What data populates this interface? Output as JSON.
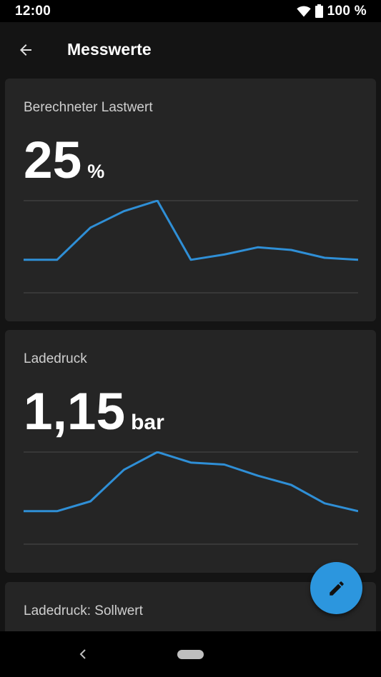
{
  "status_bar": {
    "time": "12:00",
    "battery": "100 %"
  },
  "app_bar": {
    "title": "Messwerte",
    "back_icon": "arrow-back-icon"
  },
  "cards": [
    {
      "label": "Berechneter Lastwert",
      "value": "25",
      "unit": "%",
      "chart_data": {
        "type": "line",
        "color": "#2f8fd6",
        "values": [
          1.0,
          1.0,
          5.9,
          8.4,
          10.0,
          1.0,
          1.8,
          2.9,
          2.5,
          1.3,
          1.0
        ],
        "ylim": [
          0,
          10
        ]
      }
    },
    {
      "label": "Ladedruck",
      "value": "1,15",
      "unit": "bar",
      "chart_data": {
        "type": "line",
        "color": "#2f8fd6",
        "values": [
          1.0,
          1.0,
          2.5,
          7.3,
          10.0,
          8.4,
          8.1,
          6.4,
          5.0,
          2.2,
          1.0
        ],
        "ylim": [
          0,
          10
        ]
      }
    },
    {
      "label": "Ladedruck: Sollwert"
    }
  ],
  "fab": {
    "icon": "pencil-icon",
    "color": "#2c96de"
  },
  "nav_bar": {
    "back_icon": "nav-back-icon",
    "home_icon": "home-pill-icon"
  },
  "colors": {
    "background": "#141414",
    "card": "#252525",
    "accent": "#2c96de",
    "line": "#2f8fd6",
    "gridline": "#4a4a4a"
  }
}
